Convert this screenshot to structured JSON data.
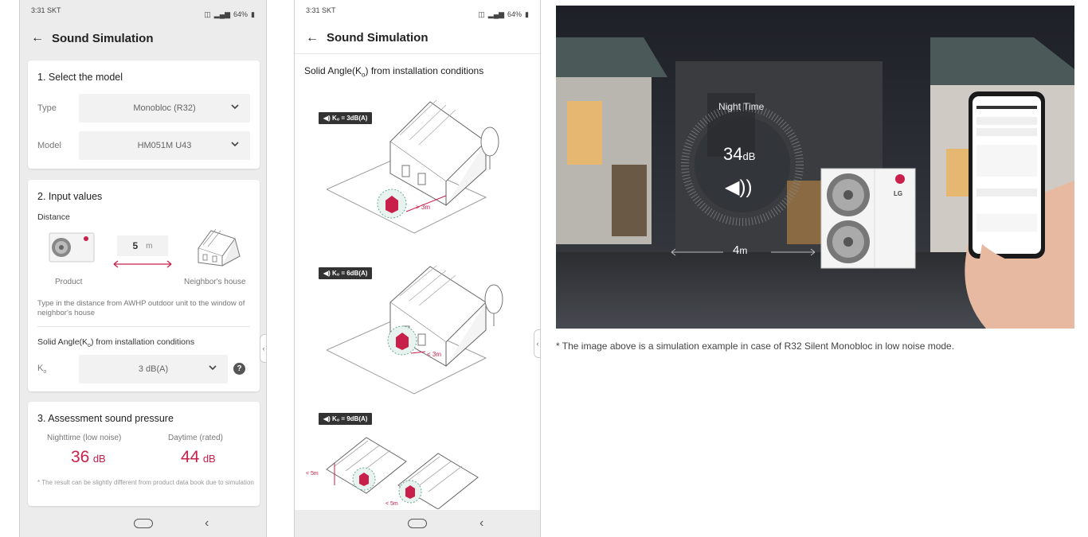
{
  "left_phone": {
    "status_time": "3:31 SKT",
    "status_battery": "64%",
    "title": "Sound Simulation",
    "section1": {
      "heading": "1. Select the model",
      "type_label": "Type",
      "type_value": "Monobloc (R32)",
      "model_label": "Model",
      "model_value": "HM051M U43"
    },
    "section2": {
      "heading": "2. Input values",
      "distance_label": "Distance",
      "distance_value": "5",
      "distance_unit": "m",
      "product_label": "Product",
      "neighbor_label": "Neighbor's house",
      "hint": "Type in the distance from AWHP outdoor unit to the window of neighbor's house",
      "solid_angle_label_pre": "Solid Angle(K",
      "solid_angle_label_sub": "o",
      "solid_angle_label_post": ") from installation conditions",
      "ko_label": "K",
      "ko_sub": "o",
      "ko_value": "3 dB(A)"
    },
    "section3": {
      "heading": "3. Assessment sound pressure",
      "night_label": "Nighttime (low noise)",
      "night_value": "36",
      "day_label": "Daytime (rated)",
      "day_value": "44",
      "unit": "dB",
      "note": "* The result can be slightly different from product data book due to simulation"
    }
  },
  "right_phone": {
    "status_time": "3:31 SKT",
    "status_battery": "64%",
    "title": "Sound Simulation",
    "subtitle_pre": "Solid Angle(K",
    "subtitle_sub": "o",
    "subtitle_post": ") from installation conditions",
    "badges": [
      {
        "text": "Kₒ = 3dB(A)",
        "distance": "> 3m"
      },
      {
        "text": "Kₒ = 6dB(A)",
        "distance": "< 3m"
      },
      {
        "text": "Kₒ = 9dB(A)",
        "distance": "< 5m",
        "distance2": "< 5m"
      }
    ]
  },
  "photo": {
    "night_time_label": "Night Time",
    "night_value": "34",
    "night_unit": "dB",
    "distance_value": "4",
    "distance_unit": "m",
    "brand": "LG"
  },
  "caption": "* The image above is a simulation example in case of R32 Silent Monobloc in low noise mode.",
  "colors": {
    "accent_red": "#c8204a",
    "text_dark": "#222222",
    "card_bg": "#ffffff",
    "screen_bg": "#ececec"
  }
}
